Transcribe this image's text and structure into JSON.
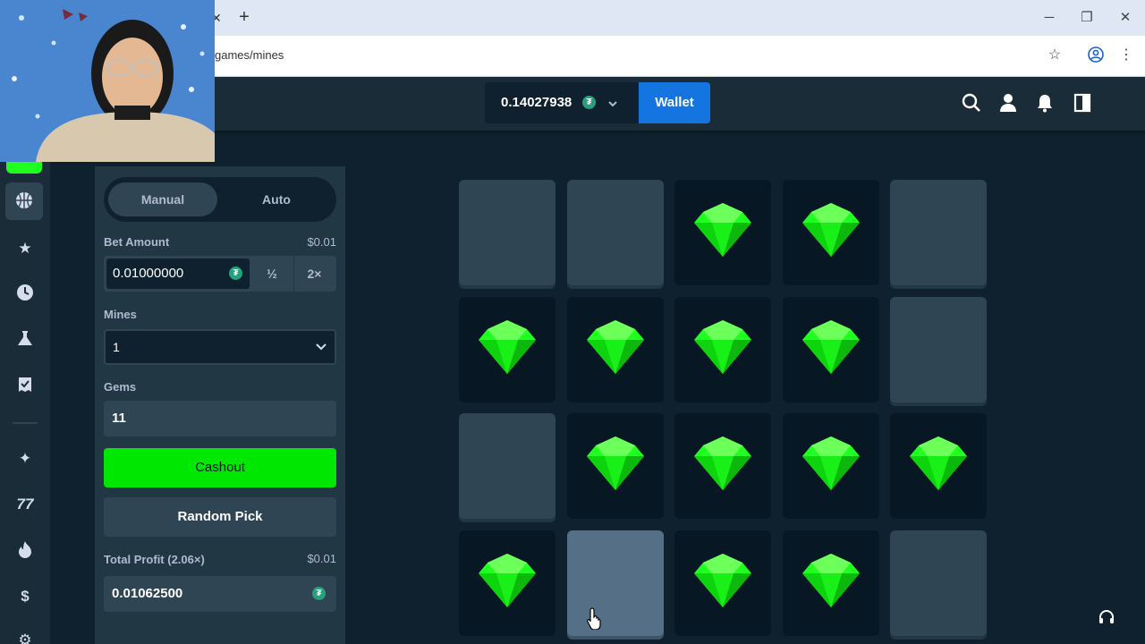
{
  "browser": {
    "url_text": "games/mines"
  },
  "header": {
    "balance": "0.14027938",
    "wallet_label": "Wallet"
  },
  "panel": {
    "mode_tabs": [
      "Manual",
      "Auto"
    ],
    "bet_amount_label": "Bet Amount",
    "bet_amount_usd": "$0.01",
    "bet_amount_value": "0.01000000",
    "half_label": "½",
    "double_label": "2×",
    "mines_label": "Mines",
    "mines_value": "1",
    "gems_label": "Gems",
    "gems_value": "11",
    "cashout_label": "Cashout",
    "random_pick_label": "Random Pick",
    "total_profit_label": "Total Profit (2.06×)",
    "total_profit_usd": "$0.01",
    "total_profit_value": "0.01062500"
  },
  "board": {
    "rows": [
      [
        "hidden",
        "hidden",
        "gem",
        "gem",
        "hidden"
      ],
      [
        "gem",
        "gem",
        "gem",
        "gem",
        "hidden"
      ],
      [
        "hidden",
        "gem",
        "gem",
        "gem",
        "gem"
      ],
      [
        "gem",
        "hover",
        "gem",
        "gem",
        "hidden"
      ]
    ]
  },
  "colors": {
    "accent_green": "#00e701",
    "gem_green": "#1fff20",
    "wallet_blue": "#1475e1",
    "tile_hidden": "#2f4553"
  },
  "icons": [
    "search-icon",
    "user-icon",
    "bell-icon",
    "sidebar-toggle-icon",
    "star-icon",
    "clock-icon",
    "flask-icon",
    "ticket-icon",
    "sparkle-icon",
    "hash-icon",
    "fire-icon",
    "coin-icon",
    "headset-icon"
  ]
}
